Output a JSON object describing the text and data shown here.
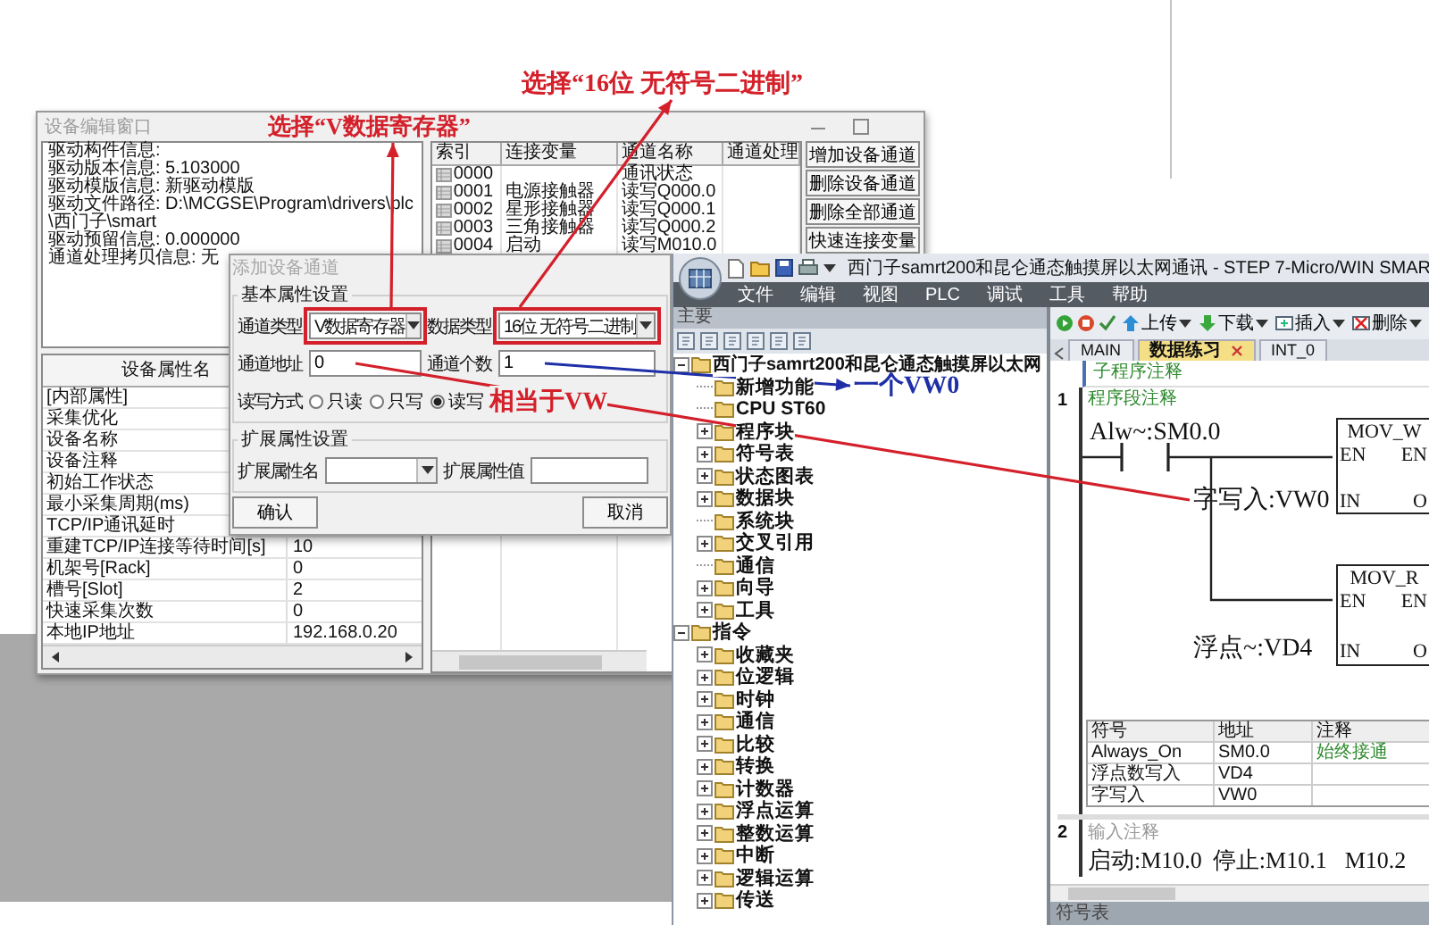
{
  "annotations": [
    {
      "text": "选择“16位 无符号二进制”",
      "color": "#d3202a"
    },
    {
      "text": "选择“V数据寄存器”",
      "color": "#d3202a"
    },
    {
      "text": "相当于VW",
      "color": "#d3202a"
    },
    {
      "text": "一个VW0",
      "color": "#1f2fa8"
    }
  ],
  "device_window": {
    "title": "设备编辑窗口",
    "info_lines": [
      "驱动构件信息:",
      "驱动版本信息: 5.103000",
      "驱动模版信息: 新驱动模版",
      "驱动文件路径: D:\\MCGSE\\Program\\drivers\\plc\\西门子\\smart",
      "驱动预留信息: 0.000000",
      "通道处理拷贝信息: 无"
    ],
    "channel_table": {
      "columns": [
        "索引",
        "连接变量",
        "通道名称",
        "通道处理"
      ],
      "rows": [
        {
          "index": "0000",
          "channel_name": "通讯状态"
        },
        {
          "index": "0001",
          "variable": "电源接触器",
          "channel_name": "读写Q000.0"
        },
        {
          "index": "0002",
          "variable": "星形接触器",
          "channel_name": "读写Q000.1"
        },
        {
          "index": "0003",
          "variable": "三角接触器",
          "channel_name": "读写Q000.2"
        },
        {
          "index": "0004",
          "variable": "启动",
          "channel_name": "读写M010.0"
        }
      ]
    },
    "buttons": [
      "增加设备通道",
      "删除设备通道",
      "删除全部通道",
      "快速连接变量"
    ],
    "property_table": {
      "columns": [
        "设备属性名"
      ],
      "rows": [
        {
          "name": "[内部属性]"
        },
        {
          "name": "采集优化"
        },
        {
          "name": "设备名称"
        },
        {
          "name": "设备注释"
        },
        {
          "name": "初始工作状态"
        },
        {
          "name": "最小采集周期(ms)"
        },
        {
          "name": "TCP/IP通讯延时"
        },
        {
          "name": "重建TCP/IP连接等待时间[s]",
          "value": "10"
        },
        {
          "name": "机架号[Rack]",
          "value": "0"
        },
        {
          "name": "槽号[Slot]",
          "value": "2"
        },
        {
          "name": "快速采集次数",
          "value": "0"
        },
        {
          "name": "本地IP地址",
          "value": "192.168.0.20"
        }
      ]
    }
  },
  "add_channel_dialog": {
    "title": "添加设备通道",
    "basic_group": {
      "title": "基本属性设置",
      "channel_type_label": "通道类型",
      "channel_type": "V数据寄存器",
      "data_type_label": "数据类型",
      "data_type": "16位 无符号二进制",
      "address_label": "通道地址",
      "address": "0",
      "count_label": "通道个数",
      "count": "1",
      "access_label": "读写方式",
      "access_options": [
        {
          "label": "只读",
          "selected": false
        },
        {
          "label": "只写",
          "selected": false
        },
        {
          "label": "读写",
          "selected": true
        }
      ]
    },
    "extended_group": {
      "title": "扩展属性设置",
      "name_label": "扩展属性名",
      "value_label": "扩展属性值"
    },
    "buttons": [
      "确认",
      "取消"
    ]
  },
  "step7": {
    "title": "西门子samrt200和昆仑通态触摸屏以太网通讯 - STEP 7-Micro/WIN SMAR",
    "menu": [
      "文件",
      "编辑",
      "视图",
      "PLC",
      "调试",
      "工具",
      "帮助"
    ],
    "project_pane": {
      "title": "主要",
      "tree": [
        {
          "label": "西门子samrt200和昆仑通态触摸屏以太网",
          "expanded": true,
          "children": [
            {
              "label": "新增功能"
            },
            {
              "label": "CPU ST60"
            },
            {
              "label": "程序块",
              "expanded": false
            },
            {
              "label": "符号表",
              "expanded": false
            },
            {
              "label": "状态图表",
              "expanded": false
            },
            {
              "label": "数据块",
              "expanded": false
            },
            {
              "label": "系统块"
            },
            {
              "label": "交叉引用",
              "expanded": false
            },
            {
              "label": "通信"
            },
            {
              "label": "向导",
              "expanded": false
            },
            {
              "label": "工具",
              "expanded": false
            }
          ]
        },
        {
          "label": "指令",
          "expanded": true,
          "children": [
            {
              "label": "收藏夹",
              "expanded": false
            },
            {
              "label": "位逻辑",
              "expanded": false
            },
            {
              "label": "时钟",
              "expanded": false
            },
            {
              "label": "通信",
              "expanded": false
            },
            {
              "label": "比较",
              "expanded": false
            },
            {
              "label": "转换",
              "expanded": false
            },
            {
              "label": "计数器",
              "expanded": false
            },
            {
              "label": "浮点运算",
              "expanded": false
            },
            {
              "label": "整数运算",
              "expanded": false
            },
            {
              "label": "中断",
              "expanded": false
            },
            {
              "label": "逻辑运算",
              "expanded": false
            },
            {
              "label": "传送",
              "expanded": false
            }
          ]
        }
      ]
    },
    "toolbar": [
      {
        "kind": "upload",
        "label": "上传"
      },
      {
        "kind": "download",
        "label": "下载"
      },
      {
        "kind": "insert",
        "label": "插入"
      },
      {
        "kind": "delete",
        "label": "删除"
      }
    ],
    "tabs": [
      {
        "label": "MAIN",
        "selected": false
      },
      {
        "label": "数据练习",
        "selected": true
      },
      {
        "label": "INT_0",
        "selected": false
      }
    ],
    "editor": {
      "subroutine_comment": "子程序注释",
      "network_1": {
        "number": "1",
        "comment": "程序段注释",
        "contact": "Alw~:SM0.0",
        "boxes": [
          {
            "title": "MOV_W",
            "left_pins": [
              "EN",
              "IN"
            ],
            "right_pins": [
              "EN",
              "O"
            ],
            "input": "字写入:VW0"
          },
          {
            "title": "MOV_R",
            "left_pins": [
              "EN",
              "IN"
            ],
            "right_pins": [
              "EN",
              "O"
            ],
            "input": "浮点~:VD4"
          }
        ],
        "symbol_table": {
          "columns": [
            "符号",
            "地址",
            "注释"
          ],
          "rows": [
            [
              "Always_On",
              "SM0.0",
              "始终接通"
            ],
            [
              "浮点数写入",
              "VD4"
            ],
            [
              "字写入",
              "VW0"
            ]
          ]
        }
      },
      "network_2": {
        "number": "2",
        "placeholder": "输入注释",
        "operands": [
          "启动:M10.0",
          "停止:M10.1",
          "M10.2"
        ]
      }
    },
    "status_bar": "符号表"
  }
}
